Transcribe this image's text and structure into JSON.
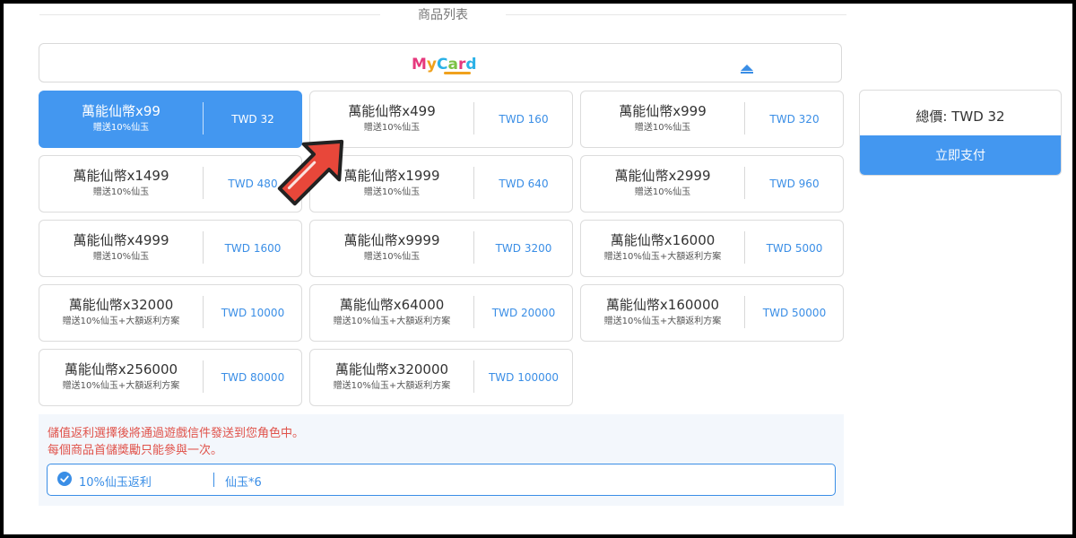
{
  "section": {
    "title": "商品列表"
  },
  "brand": {
    "name": "MyCard"
  },
  "products": [
    {
      "name": "萬能仙幣x99",
      "bonus": "贈送10%仙玉",
      "price": "TWD 32",
      "selected": true
    },
    {
      "name": "萬能仙幣x499",
      "bonus": "贈送10%仙玉",
      "price": "TWD 160"
    },
    {
      "name": "萬能仙幣x999",
      "bonus": "贈送10%仙玉",
      "price": "TWD 320"
    },
    {
      "name": "萬能仙幣x1499",
      "bonus": "贈送10%仙玉",
      "price": "TWD 480"
    },
    {
      "name": "萬能仙幣x1999",
      "bonus": "贈送10%仙玉",
      "price": "TWD 640"
    },
    {
      "name": "萬能仙幣x2999",
      "bonus": "贈送10%仙玉",
      "price": "TWD 960"
    },
    {
      "name": "萬能仙幣x4999",
      "bonus": "贈送10%仙玉",
      "price": "TWD 1600"
    },
    {
      "name": "萬能仙幣x9999",
      "bonus": "贈送10%仙玉",
      "price": "TWD 3200"
    },
    {
      "name": "萬能仙幣x16000",
      "bonus": "贈送10%仙玉+大額返利方案",
      "price": "TWD 5000"
    },
    {
      "name": "萬能仙幣x32000",
      "bonus": "贈送10%仙玉+大額返利方案",
      "price": "TWD 10000"
    },
    {
      "name": "萬能仙幣x64000",
      "bonus": "贈送10%仙玉+大額返利方案",
      "price": "TWD 20000"
    },
    {
      "name": "萬能仙幣x160000",
      "bonus": "贈送10%仙玉+大額返利方案",
      "price": "TWD 50000"
    },
    {
      "name": "萬能仙幣x256000",
      "bonus": "贈送10%仙玉+大額返利方案",
      "price": "TWD 80000"
    },
    {
      "name": "萬能仙幣x320000",
      "bonus": "贈送10%仙玉+大額返利方案",
      "price": "TWD 100000"
    }
  ],
  "summary": {
    "total": "總價: TWD 32",
    "pay_label": "立即支付"
  },
  "rebate": {
    "note1": "儲值返利選擇後將通過遊戲信件發送到您角色中。",
    "note2": "每個商品首儲獎勵只能參與一次。",
    "option_label": "10%仙玉返利",
    "option_reward": "仙玉*6"
  },
  "colors": {
    "accent": "#4397f0",
    "link": "#3a8ee6",
    "warning": "#e0524a",
    "arrow": "#e8473a"
  },
  "icons": {
    "logo": "mycard-logo",
    "caret": "caret-up-icon",
    "check": "check-circle-icon",
    "pointer": "red-arrow-icon"
  }
}
